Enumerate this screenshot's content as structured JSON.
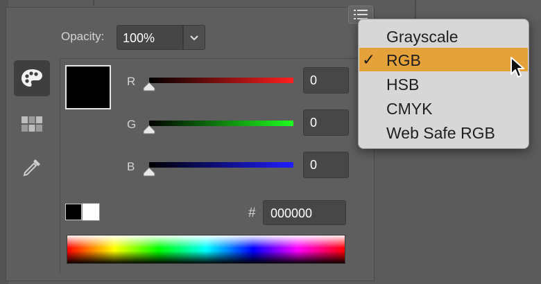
{
  "opacity": {
    "label": "Opacity:",
    "value": "100%"
  },
  "tools": [
    {
      "name": "color-palette"
    },
    {
      "name": "swatches"
    },
    {
      "name": "eyedropper"
    }
  ],
  "channels": [
    {
      "label": "R",
      "value": "0",
      "level": 0,
      "color": "#ff1e1e"
    },
    {
      "label": "G",
      "value": "0",
      "level": 0,
      "color": "#1eff1e"
    },
    {
      "label": "B",
      "value": "0",
      "level": 0,
      "color": "#1e1eff"
    }
  ],
  "hex": {
    "symbol": "#",
    "value": "000000"
  },
  "current_color": "#000000",
  "color_mode_menu": {
    "items": [
      "Grayscale",
      "RGB",
      "HSB",
      "CMYK",
      "Web Safe RGB"
    ],
    "selected": "RGB",
    "check_glyph": "✓"
  }
}
